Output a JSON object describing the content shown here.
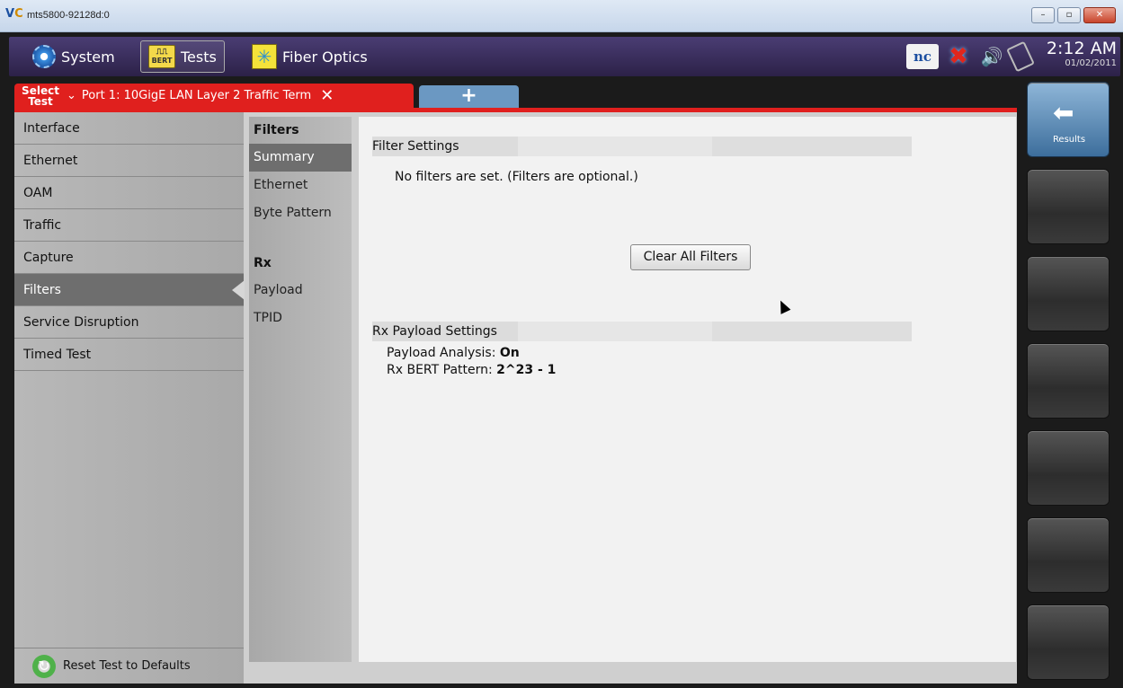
{
  "window": {
    "title": "mts5800-92128d:0",
    "logo": "V",
    "logo_sup": "C",
    "btn_min": "–",
    "btn_max": "▫",
    "btn_close": "✕"
  },
  "topbar": {
    "system_label": "System",
    "tests_label": "Tests",
    "bert_text": "BERT",
    "fiber_label": "Fiber Optics",
    "nc_text": "nc",
    "time": "2:12 AM",
    "date": "01/02/2011"
  },
  "tabs": {
    "select_test": "Select Test",
    "active_tab": "Port 1: 10GigE LAN Layer 2 Traffic Term",
    "close_glyph": "✕",
    "add_glyph": "+"
  },
  "leftnav": {
    "items": [
      "Interface",
      "Ethernet",
      "OAM",
      "Traffic",
      "Capture",
      "Filters",
      "Service Disruption",
      "Timed Test"
    ],
    "active_index": 5,
    "reset_label": "Reset Test to Defaults"
  },
  "subnav": {
    "filters_heading": "Filters",
    "filters_items": [
      "Summary",
      "Ethernet",
      "Byte Pattern"
    ],
    "rx_heading": "Rx",
    "rx_items": [
      "Payload",
      "TPID"
    ]
  },
  "content": {
    "filter_settings_title": "Filter Settings",
    "no_filters_text": "No filters are set. (Filters are optional.)",
    "clear_button": "Clear All Filters",
    "rx_payload_title": "Rx Payload Settings",
    "payload_analysis_label": "Payload Analysis:",
    "payload_analysis_value": "On",
    "rx_bert_label": "Rx BERT Pattern:",
    "rx_bert_value": "2^23 - 1"
  },
  "rightbar": {
    "results_label": "Results",
    "results_arrow": "⬅"
  }
}
